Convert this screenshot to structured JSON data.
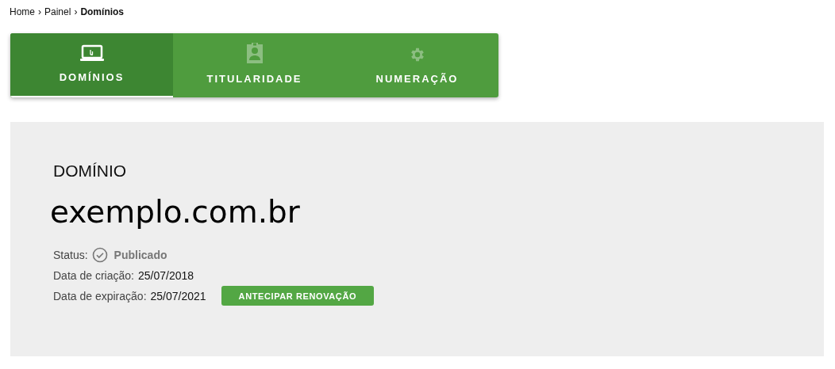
{
  "breadcrumb": [
    {
      "label": "Home",
      "current": false
    },
    {
      "label": "Painel",
      "current": false
    },
    {
      "label": "Domínios",
      "current": true
    }
  ],
  "breadcrumb_separator": "›",
  "tabs": [
    {
      "label": "DOMÍNIOS",
      "kind": "laptop",
      "selected": true
    },
    {
      "label": "TITULARIDADE",
      "kind": "badge",
      "selected": false
    },
    {
      "label": "NUMERAÇÃO",
      "kind": "gear",
      "selected": false
    }
  ],
  "panel": {
    "heading": "DOMÍNIO",
    "domain": "exemplo.com.br",
    "status": {
      "label": "Status:",
      "value": "Publicado"
    },
    "details": [
      {
        "label": "Data de criação:",
        "value": "25/07/2018"
      },
      {
        "label": "Data de expiração:",
        "value": "25/07/2021",
        "action": "ANTECIPAR RENOVAÇÃO"
      }
    ]
  }
}
